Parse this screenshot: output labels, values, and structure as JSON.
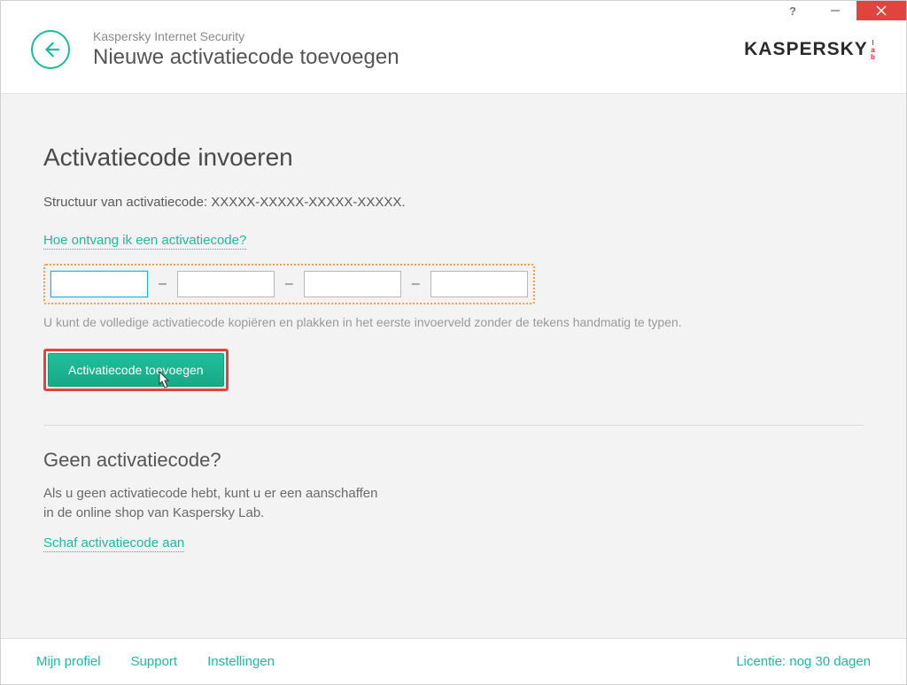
{
  "app_name": "Kaspersky Internet Security",
  "page_title": "Nieuwe activatiecode toevoegen",
  "brand": {
    "main": "KASPERSKY",
    "suffix": "lab"
  },
  "main": {
    "heading": "Activatiecode invoeren",
    "structure": "Structuur van activatiecode: XXXXX-XXXXX-XXXXX-XXXXX.",
    "how_link": "Hoe ontvang ik een activatiecode?",
    "dash": "–",
    "hint": "U kunt de volledige activatiecode kopiëren en plakken in het eerste invoerveld zonder de tekens handmatig te typen.",
    "submit_label": "Activatiecode toevoegen"
  },
  "nocode": {
    "heading": "Geen activatiecode?",
    "body_line1": "Als u geen activatiecode hebt, kunt u er een aanschaffen",
    "body_line2": "in de online shop van Kaspersky Lab.",
    "buy_link": "Schaf activatiecode aan"
  },
  "footer": {
    "profile": "Mijn profiel",
    "support": "Support",
    "settings": "Instellingen",
    "license": "Licentie: nog 30 dagen"
  },
  "colors": {
    "accent": "#1bbc9b",
    "danger": "#e0443e",
    "highlight_border": "#f0a04a"
  }
}
